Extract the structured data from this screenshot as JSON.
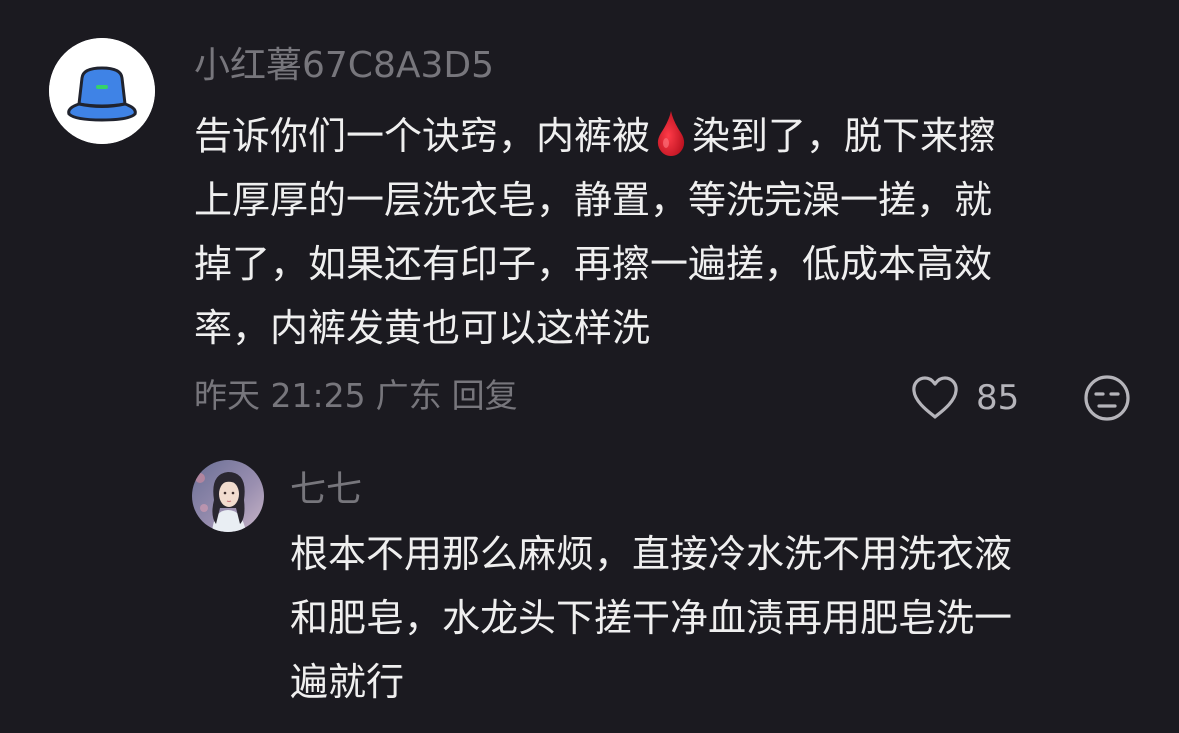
{
  "comment": {
    "username": "小红薯67C8A3D5",
    "avatar_icon": "blue-bucket-hat-icon",
    "body": {
      "line1_before_icon": "告诉你们一个诀窍，内裤被",
      "inline_icon": "blood-drop-icon",
      "line1_after_icon": "染到了，脱下来擦",
      "line2": "上厚厚的一层洗衣皂，静置，等洗完澡一搓，就",
      "line3": "掉了，如果还有印子，再擦一遍搓，低成本高效",
      "line4": "率，内裤发黄也可以这样洗"
    },
    "time": "昨天 21:25",
    "location": "广东",
    "reply_label": "回复",
    "likes": "85",
    "like_icon": "heart-outline-icon",
    "dislike_icon": "unamused-face-icon"
  },
  "reply": {
    "username": "七七",
    "avatar_icon": "user-photo-avatar",
    "body": {
      "line1": "根本不用那么麻烦，直接冷水洗不用洗衣液",
      "line2": "和肥皂，水龙头下搓干净血渍再用肥皂洗一",
      "line3": "遍就行"
    }
  },
  "colors": {
    "background": "#1b1a20",
    "primary_text": "#efefef",
    "secondary_text": "#77767c",
    "hat_blue": "#3f83e6",
    "hat_band_green": "#35d36a",
    "blood_red": "#d01b2a"
  }
}
